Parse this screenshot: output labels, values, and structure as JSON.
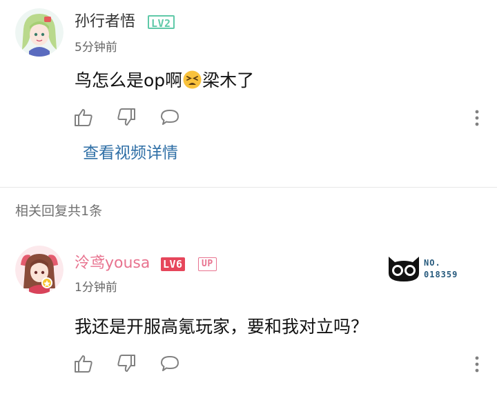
{
  "comment": {
    "username": "孙行者悟",
    "level": "LV2",
    "time": "5分钟前",
    "text_before_emoji": "鸟怎么是op啊",
    "emoji": "tired-face-emoji",
    "text_after_emoji": "梁木了",
    "view_video_link": "查看视频详情"
  },
  "related_header": "相关回复共1条",
  "reply": {
    "username": "泠鸢yousa",
    "level": "LV6",
    "up_badge": "UP",
    "time": "1分钟前",
    "text": "我还是开服高氪玩家，要和我对立吗？",
    "fan_badge": {
      "line1": "NO.",
      "line2": "018359"
    }
  },
  "colors": {
    "lv2_green": "#5fc9a8",
    "lv6_red": "#e6465b",
    "pink_username": "#e8738f",
    "link_blue": "#2f6fa6",
    "icon_gray": "#808080"
  },
  "icons": [
    "thumb-up-icon",
    "thumb-down-icon",
    "comment-bubble-icon",
    "more-vertical-icon"
  ]
}
